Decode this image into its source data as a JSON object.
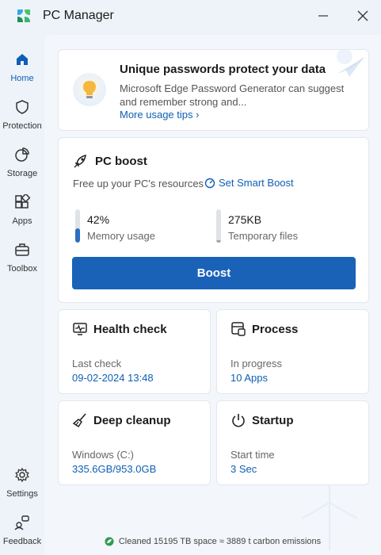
{
  "window": {
    "title": "PC Manager"
  },
  "sidebar": {
    "items": [
      {
        "label": "Home",
        "icon": "home-icon",
        "active": true
      },
      {
        "label": "Protection",
        "icon": "shield-icon"
      },
      {
        "label": "Storage",
        "icon": "pie-chart-icon"
      },
      {
        "label": "Apps",
        "icon": "apps-grid-icon"
      },
      {
        "label": "Toolbox",
        "icon": "toolbox-icon"
      },
      {
        "label": "Settings",
        "icon": "gear-icon"
      },
      {
        "label": "Feedback",
        "icon": "feedback-icon"
      }
    ]
  },
  "promo": {
    "title": "Unique passwords protect your data",
    "description": "Microsoft Edge Password Generator can suggest and remember strong and...",
    "link": "More usage tips",
    "icon": "lightbulb-icon"
  },
  "boost": {
    "title": "PC boost",
    "subtitle": "Free up your PC's resources",
    "smart_link": "Set Smart Boost",
    "memory": {
      "value": "42%",
      "label": "Memory usage",
      "level": 0.42
    },
    "temp": {
      "value": "275KB",
      "label": "Temporary files",
      "level": 0.03
    },
    "button": "Boost"
  },
  "tiles": {
    "health": {
      "title": "Health check",
      "label": "Last check",
      "value": "09-02-2024 13:48"
    },
    "process": {
      "title": "Process",
      "label": "In progress",
      "value": "10 Apps"
    },
    "cleanup": {
      "title": "Deep cleanup",
      "label": "Windows (C:)",
      "value": "335.6GB/953.0GB"
    },
    "startup": {
      "title": "Startup",
      "label": "Start time",
      "value": "3 Sec"
    }
  },
  "footer": {
    "text": "Cleaned 15195 TB space ≈ 3889 t carbon emissions"
  },
  "colors": {
    "accent": "#1a62b8",
    "link": "#0f5fb3",
    "memory_bar": "#2b6fc0",
    "temp_bar": "#9aa3ad"
  }
}
